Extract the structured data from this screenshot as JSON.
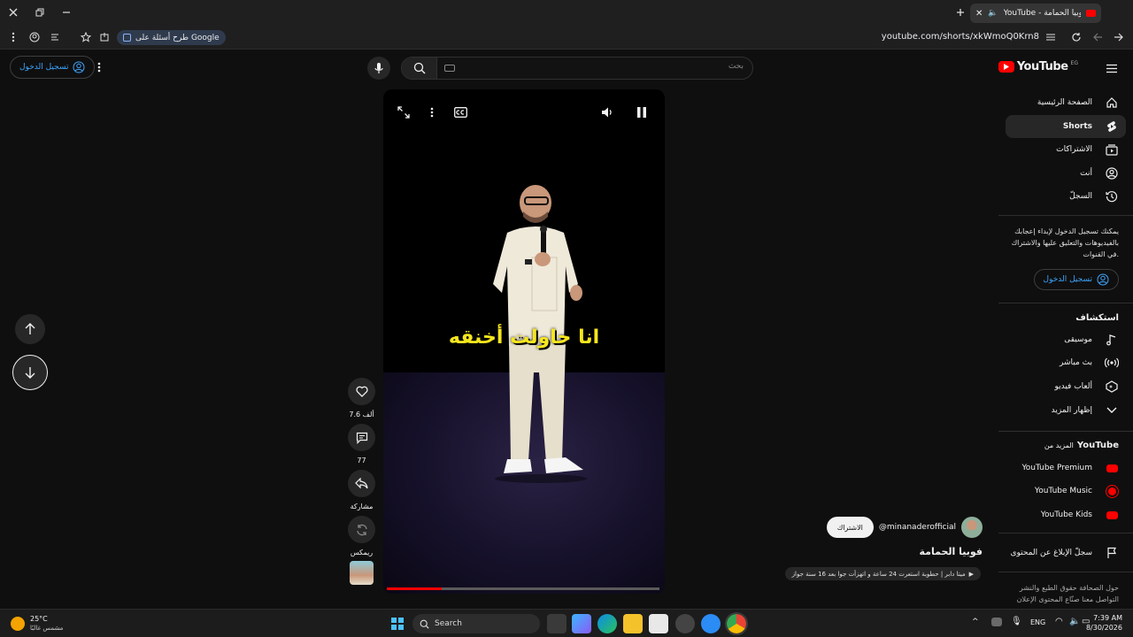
{
  "browser": {
    "tab_title": "YouTube - فوبيا الحمامة",
    "url": "youtube.com/shorts/xkWmoQ0Krn8",
    "google_chip": "طرح أسئلة على Google"
  },
  "header": {
    "logo_text": "YouTube",
    "region": "EG",
    "search_placeholder": "بحث",
    "sign_in": "تسجيل الدخول"
  },
  "sidebar": {
    "items": [
      {
        "label": "الصفحة الرئيسية",
        "icon": "home-icon"
      },
      {
        "label": "Shorts",
        "icon": "shorts-icon"
      },
      {
        "label": "الاشتراكات",
        "icon": "subscriptions-icon"
      },
      {
        "label": "أنت",
        "icon": "you-icon"
      },
      {
        "label": "السجلّ",
        "icon": "history-icon"
      }
    ],
    "signin_note": "يمكنك تسجيل الدخول لإبداء إعجابك بالفيديوهات والتعليق عليها والاشتراك في القنوات.",
    "signin_button": "تسجيل الدخول",
    "explore_heading": "استكشاف",
    "explore": [
      {
        "label": "موسيقى",
        "icon": "music-icon"
      },
      {
        "label": "بث مباشر",
        "icon": "live-icon"
      },
      {
        "label": "ألعاب فيديو",
        "icon": "gaming-icon"
      },
      {
        "label": "إظهار المزيد",
        "icon": "chevron-down-icon"
      }
    ],
    "more_heading_prefix": "المزيد من",
    "more_heading_brand": "YouTube",
    "more": [
      "YouTube Premium",
      "YouTube Music",
      "YouTube Kids"
    ],
    "report": "سجلّ الإبلاغ عن المحتوى",
    "footer_line1": "حول  الصحافة  حقوق الطبع والنشر",
    "footer_line2": "التواصل معنا  صنّاع المحتوى  الإعلان"
  },
  "short": {
    "caption": "انا حاولت أخنقه",
    "progress": 0.2,
    "likes": "7.6 ألف",
    "comments": "77",
    "share": "مشاركة",
    "remix": "ريمكس",
    "channel": "@minanaderofficial",
    "subscribe": "الاشتراك",
    "title": "فوبيا الحمامة",
    "sound": "ميتا دابر | حطوبة استعرت 24 ساعة و اتهزأت جوا بعد 16 سنة جواز"
  },
  "taskbar": {
    "temp": "25°C",
    "weather": "مشمس غالبًا",
    "search": "Search",
    "lang": "ENG",
    "time": "7:39 AM",
    "date": "8/30/2026"
  },
  "colors": {
    "accent": "#ff0000",
    "link": "#3ea6ff",
    "caption": "#f6e61e"
  }
}
